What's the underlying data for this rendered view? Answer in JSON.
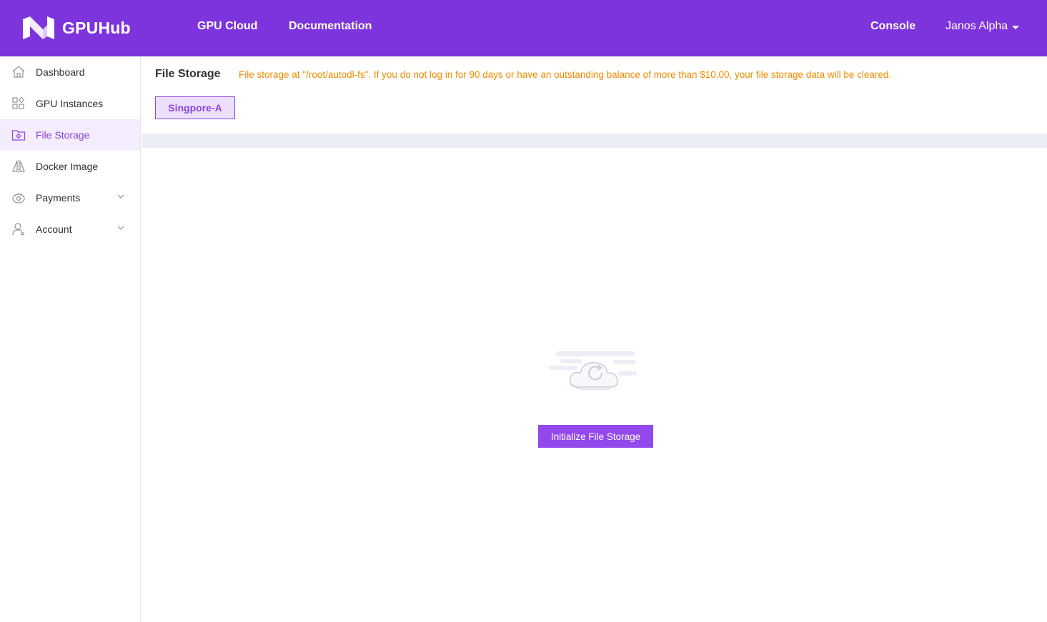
{
  "header": {
    "brand": "GPUHub",
    "nav": {
      "gpu_cloud": "GPU Cloud",
      "documentation": "Documentation",
      "console": "Console"
    },
    "user": "Janos Alpha"
  },
  "sidebar": {
    "items": [
      {
        "label": "Dashboard",
        "icon": "home-icon"
      },
      {
        "label": "GPU Instances",
        "icon": "grid-apps-icon"
      },
      {
        "label": "File Storage",
        "icon": "folder-settings-icon",
        "active": true
      },
      {
        "label": "Docker Image",
        "icon": "mirror-triangle-icon"
      },
      {
        "label": "Payments",
        "icon": "wallet-icon",
        "expandable": true
      },
      {
        "label": "Account",
        "icon": "user-icon",
        "expandable": true
      }
    ]
  },
  "main": {
    "title": "File Storage",
    "notice": "File storage at \"/root/autodl-fs\". If you do not log in for 90 days or have an outstanding balance of more than $10.00, your file storage data will be cleared.",
    "region_tab": "Singpore-A",
    "init_button": "Initialize File Storage"
  },
  "colors": {
    "brand": "#7e34dc",
    "accent": "#8c44dc",
    "button": "#9248ec",
    "warning": "#f08c00",
    "active_bg": "#f4ecff"
  }
}
